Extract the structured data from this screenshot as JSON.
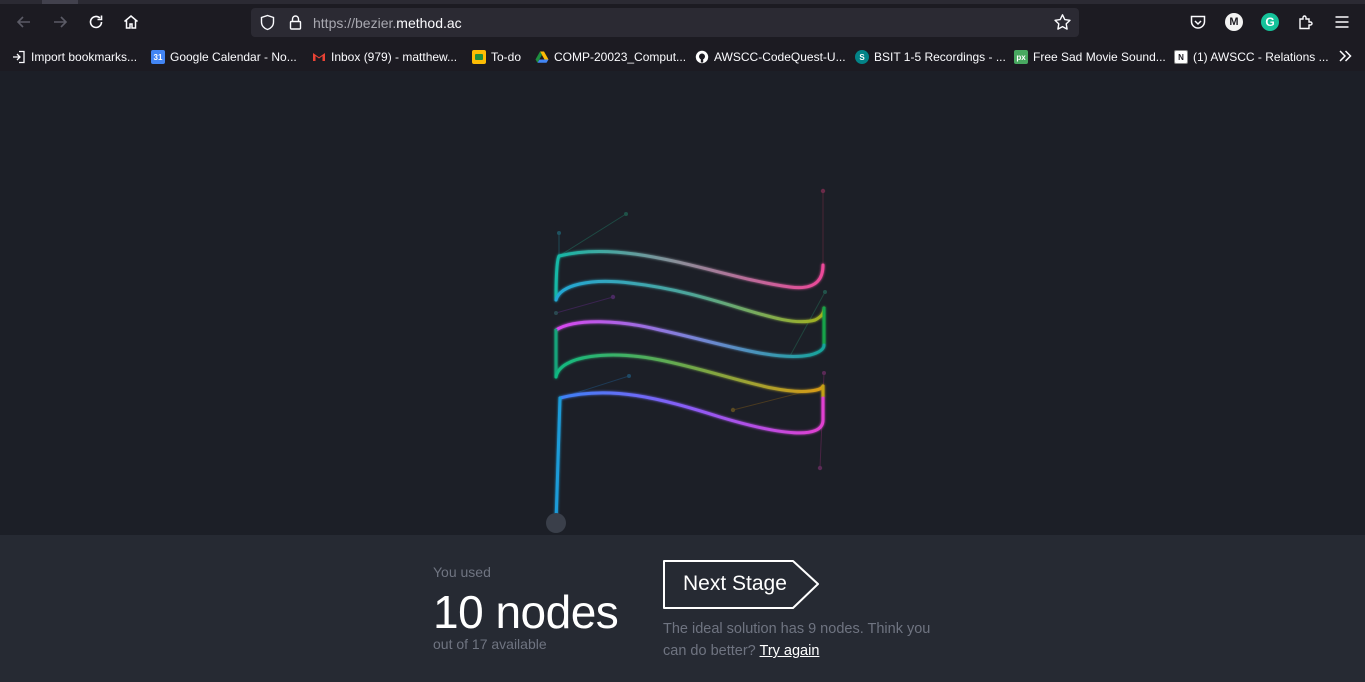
{
  "browser": {
    "url_prefix": "https://bezier.",
    "url_domain": "method.ac",
    "bookmarks": [
      {
        "label": "Import bookmarks...",
        "icon": "import-icon",
        "color": "#fbfbfe"
      },
      {
        "label": "Google Calendar - No...",
        "icon": "calendar-icon",
        "color": "#4285f4"
      },
      {
        "label": "Inbox (979) - matthew...",
        "icon": "gmail-icon",
        "color": "#ea4335"
      },
      {
        "label": "To-do",
        "icon": "classroom-icon",
        "color": "#1e8e3e"
      },
      {
        "label": "COMP-20023_Comput...",
        "icon": "drive-icon",
        "color": "#fbbc04"
      },
      {
        "label": "AWSCC-CodeQuest-U...",
        "icon": "github-icon",
        "color": "#ffffff"
      },
      {
        "label": "BSIT 1-5 Recordings - ...",
        "icon": "sharepoint-icon",
        "color": "#038387"
      },
      {
        "label": "Free Sad Movie Sound...",
        "icon": "pixabay-icon",
        "color": "#48a860"
      },
      {
        "label": "(1) AWSCC - Relations ...",
        "icon": "notion-icon",
        "color": "#ffffff"
      }
    ]
  },
  "results": {
    "you_used": "You used",
    "nodes": "10 nodes",
    "out_of": "out of 17 available",
    "next_stage": "Next Stage",
    "ideal_text": "The ideal solution has 9 nodes. Think you can do better?",
    "try_again": "Try again"
  }
}
